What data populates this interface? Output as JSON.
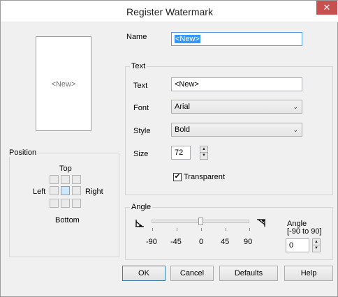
{
  "window": {
    "title": "Register Watermark",
    "close_glyph": "✕"
  },
  "preview": {
    "text": "<New>"
  },
  "name_field": {
    "label": "Name",
    "value": "<New>"
  },
  "text_group": {
    "legend": "Text",
    "text_label": "Text",
    "text_value": "<New>",
    "font_label": "Font",
    "font_value": "Arial",
    "style_label": "Style",
    "style_value": "Bold",
    "size_label": "Size",
    "size_value": "72",
    "transparent_label": "Transparent",
    "transparent_checked": true
  },
  "position_group": {
    "legend": "Position",
    "top": "Top",
    "left": "Left",
    "right": "Right",
    "bottom": "Bottom",
    "selected": "center"
  },
  "angle_group": {
    "legend": "Angle",
    "slider_value": 0,
    "slider_min": -90,
    "slider_max": 90,
    "ticks": [
      "-90",
      "-45",
      "0",
      "45",
      "90"
    ],
    "angle_label_line1": "Angle",
    "angle_label_line2": "[-90 to 90]",
    "angle_value": "0",
    "left_icon": "angle-down-left-icon",
    "right_icon": "angle-down-right-icon"
  },
  "buttons": {
    "ok": "OK",
    "cancel": "Cancel",
    "defaults": "Defaults",
    "help": "Help"
  },
  "icons": {
    "checkmark": "✔",
    "dropdown_arrow": "⌄",
    "spin_up": "▲",
    "spin_down": "▼"
  },
  "colors": {
    "selection": "#3399ff",
    "close_button": "#c75050",
    "default_button_border": "#3c7fb1"
  }
}
